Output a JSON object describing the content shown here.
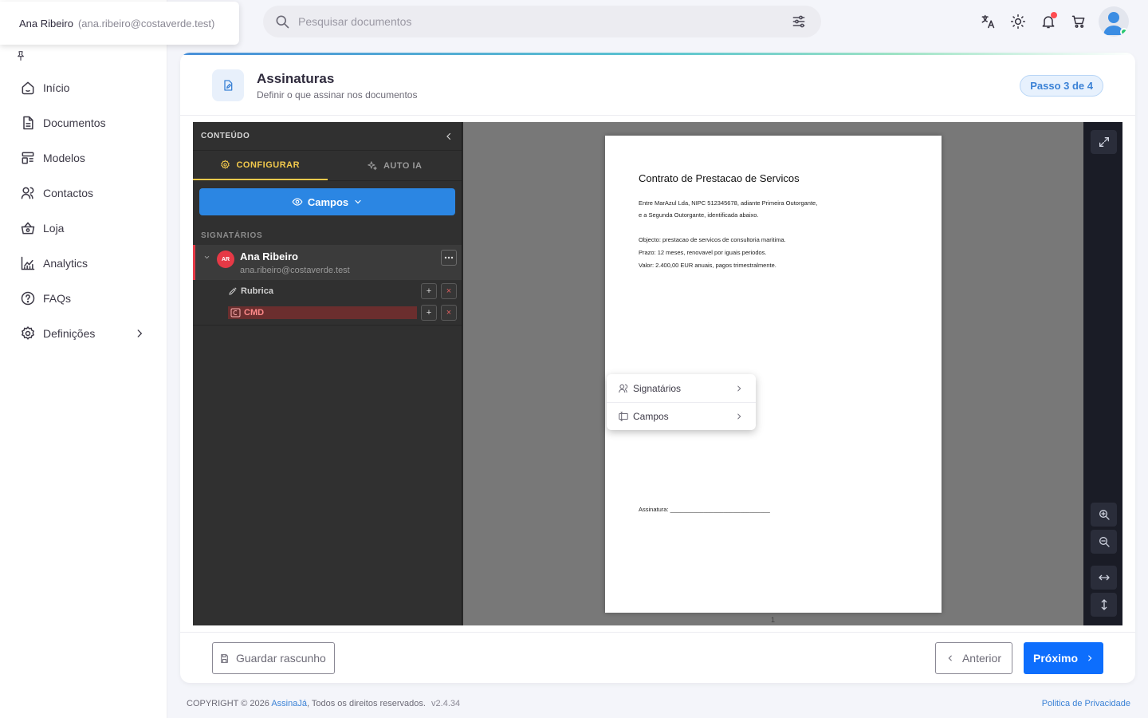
{
  "user": {
    "name": "Ana Ribeiro",
    "email": "(ana.ribeiro@costaverde.test)"
  },
  "nav": {
    "items": [
      {
        "label": "Início",
        "icon": "home-icon"
      },
      {
        "label": "Documentos",
        "icon": "document-icon"
      },
      {
        "label": "Modelos",
        "icon": "template-icon"
      },
      {
        "label": "Contactos",
        "icon": "contacts-icon"
      },
      {
        "label": "Loja",
        "icon": "basket-icon"
      },
      {
        "label": "Analytics",
        "icon": "chart-icon"
      },
      {
        "label": "FAQs",
        "icon": "help-icon"
      },
      {
        "label": "Definições",
        "icon": "settings-icon"
      }
    ]
  },
  "search": {
    "placeholder": "Pesquisar documentos"
  },
  "header": {
    "title": "Assinaturas",
    "subtitle": "Definir o que assinar nos documentos",
    "step": "Passo 3 de 4"
  },
  "panel": {
    "title": "CONTEÚDO",
    "tab_config": "CONFIGURAR",
    "tab_ai": "AUTO IA",
    "campos_button": "Campos",
    "signers_label": "SIGNATÁRIOS",
    "signer": {
      "initials": "AR",
      "name": "Ana Ribeiro",
      "email": "ana.ribeiro@costaverde.test"
    },
    "fields": [
      {
        "label": "Rubrica"
      },
      {
        "label": "CMD"
      }
    ]
  },
  "document": {
    "title": "Contrato de Prestacao de Servicos",
    "lines": [
      "Entre MarAzul Lda, NIPC 512345678, adiante Primeira Outorgante,",
      "e a Segunda Outorgante, identificada abaixo.",
      "Objecto: prestacao de servicos de consultoria maritima.",
      "Prazo: 12 meses, renovavel por iguais periodos.",
      "Valor: 2.400,00 EUR anuais, pagos trimestralmente."
    ],
    "signature_line": "Assinatura: ______________________________",
    "page_number": "1"
  },
  "context_menu": {
    "items": [
      {
        "label": "Signatários"
      },
      {
        "label": "Campos"
      }
    ]
  },
  "footer_actions": {
    "draft": "Guardar rascunho",
    "prev": "Anterior",
    "next": "Próximo"
  },
  "footer": {
    "copyright": "COPYRIGHT © 2026 ",
    "brand": "AssinaJá",
    "rights": ", Todos os direitos reservados.",
    "version": "v2.4.34",
    "privacy": "Politica de Privacidade"
  },
  "colors": {
    "accent": "#0d6efd",
    "panel_accent": "#f2c94c",
    "danger": "#e63946",
    "campos_blue": "#2b86e3"
  }
}
